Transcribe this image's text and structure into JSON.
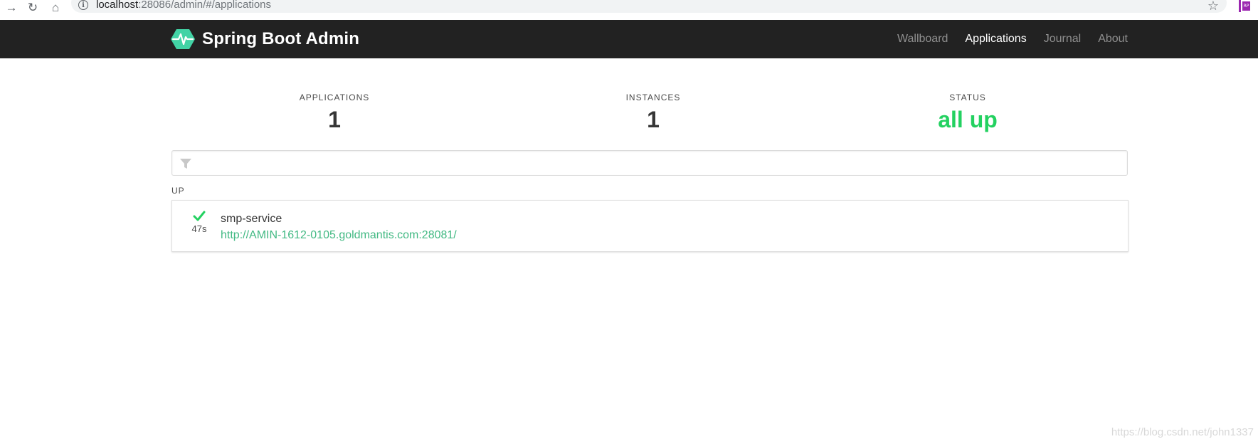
{
  "browser": {
    "url_host": "localhost",
    "url_rest": ":28086/admin/#/applications",
    "extension_badge": "RP"
  },
  "navbar": {
    "brand": "Spring Boot Admin",
    "links": [
      {
        "label": "Wallboard",
        "active": false
      },
      {
        "label": "Applications",
        "active": true
      },
      {
        "label": "Journal",
        "active": false
      },
      {
        "label": "About",
        "active": false
      }
    ]
  },
  "stats": {
    "applications": {
      "label": "APPLICATIONS",
      "value": "1"
    },
    "instances": {
      "label": "INSTANCES",
      "value": "1"
    },
    "status": {
      "label": "STATUS",
      "value": "all up"
    }
  },
  "filter": {
    "value": "",
    "placeholder": ""
  },
  "groups": [
    {
      "label": "UP",
      "apps": [
        {
          "name": "smp-service",
          "url": "http://AMIN-1612-0105.goldmantis.com:28081/",
          "uptime": "47s"
        }
      ]
    }
  ],
  "colors": {
    "navbar": "#222222",
    "brand_accent": "#42d3a5",
    "status_up": "#23d160",
    "link": "#42b983"
  },
  "watermark": "https://blog.csdn.net/john1337"
}
